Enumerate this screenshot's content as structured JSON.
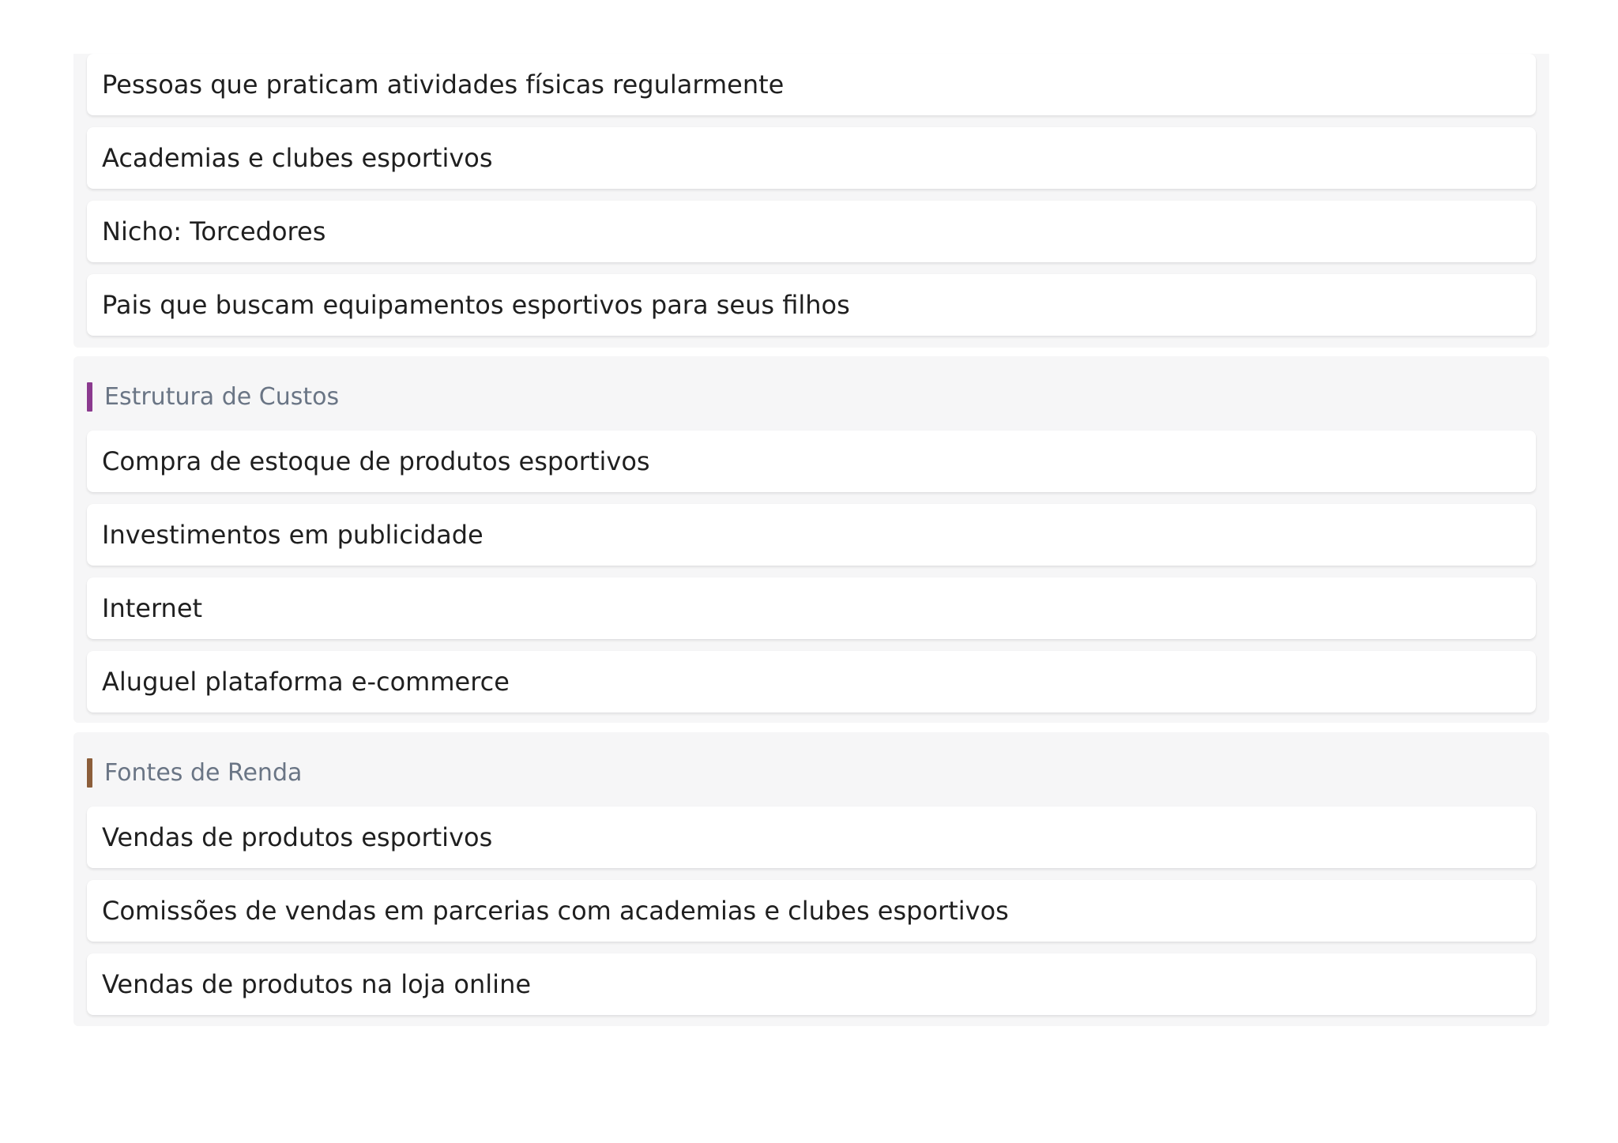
{
  "sections": {
    "clientes": {
      "items": [
        "Pessoas que praticam atividades físicas regularmente",
        "Academias e clubes esportivos",
        "Nicho: Torcedores",
        "Pais que buscam equipamentos esportivos para seus filhos"
      ]
    },
    "custos": {
      "title": "Estrutura de Custos",
      "accent_color": "#8b3a8f",
      "items": [
        "Compra de estoque de produtos esportivos",
        "Investimentos em publicidade",
        "Internet",
        "Aluguel plataforma e-commerce"
      ]
    },
    "renda": {
      "title": "Fontes de Renda",
      "accent_color": "#8c5e3a",
      "items": [
        "Vendas de produtos esportivos",
        "Comissões de vendas em parcerias com academias e clubes esportivos",
        "Vendas de produtos na loja online"
      ]
    }
  }
}
